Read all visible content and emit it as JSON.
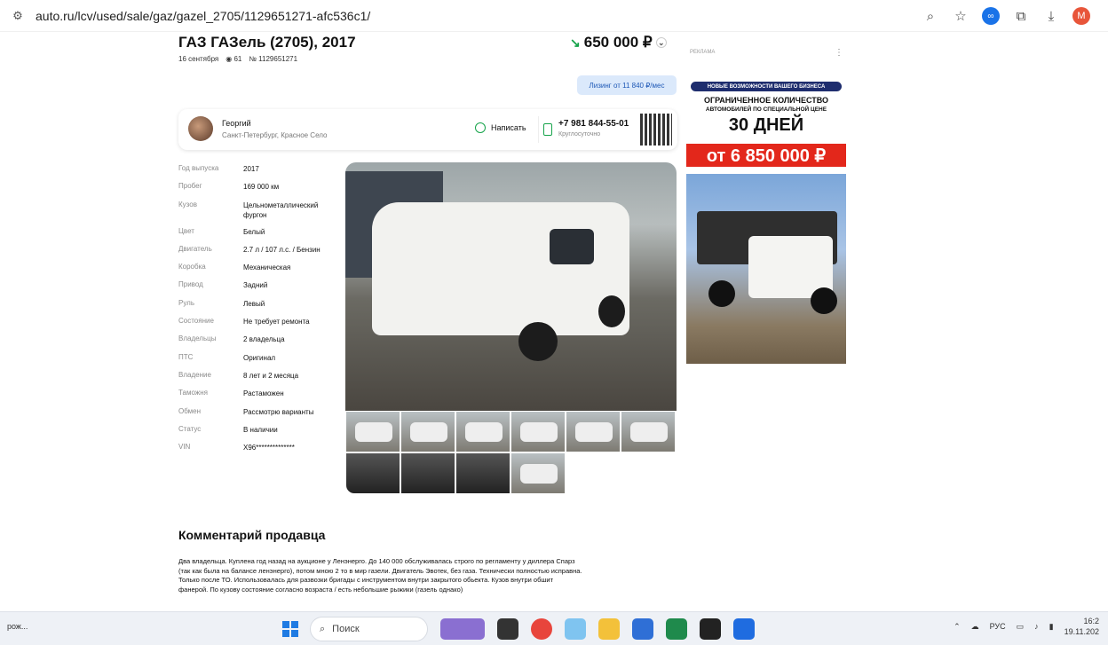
{
  "browser": {
    "url": "auto.ru/lcv/used/sale/gaz/gazel_2705/1129651271-afc536c1/",
    "profile_letter": "M"
  },
  "listing": {
    "title": "ГАЗ ГАЗель (2705), 2017",
    "date": "16 сентября",
    "views": "61",
    "number": "№ 1129651271",
    "price": "650 000 ₽",
    "leasing": "Лизинг от 11 840 ₽/мес"
  },
  "seller": {
    "name": "Георгий",
    "location": "Санкт-Петербург, Красное Село",
    "write_label": "Написать",
    "phone": "+7 981 844-55-01",
    "phone_hours": "Круглосуточно"
  },
  "specs": [
    {
      "k": "Год выпуска",
      "v": "2017"
    },
    {
      "k": "Пробег",
      "v": "169 000 км"
    },
    {
      "k": "Кузов",
      "v": "Цельнометаллический фургон"
    },
    {
      "k": "Цвет",
      "v": "Белый"
    },
    {
      "k": "Двигатель",
      "v": "2.7 л / 107 л.с. / Бензин"
    },
    {
      "k": "Коробка",
      "v": "Механическая"
    },
    {
      "k": "Привод",
      "v": "Задний"
    },
    {
      "k": "Руль",
      "v": "Левый"
    },
    {
      "k": "Состояние",
      "v": "Не требует ремонта"
    },
    {
      "k": "Владельцы",
      "v": "2 владельца"
    },
    {
      "k": "ПТС",
      "v": "Оригинал"
    },
    {
      "k": "Владение",
      "v": "8 лет и 2 месяца"
    },
    {
      "k": "Таможня",
      "v": "Растаможен"
    },
    {
      "k": "Обмен",
      "v": "Рассмотрю варианты"
    },
    {
      "k": "Статус",
      "v": "В наличии"
    },
    {
      "k": "VIN",
      "v": "X96**************"
    }
  ],
  "ad": {
    "label": "РЕКЛАМА",
    "pill": "НОВЫЕ ВОЗМОЖНОСТИ ВАШЕГО БИЗНЕСА",
    "line1": "ОГРАНИЧЕННОЕ КОЛИЧЕСТВО",
    "line2": "АВТОМОБИЛЕЙ ПО СПЕЦИАЛЬНОЙ ЦЕНЕ",
    "line3": "30 ДНЕЙ",
    "price": "от 6 850 000 ₽"
  },
  "comment": {
    "heading": "Комментарий продавца",
    "text": "Два владельца. Куплена год назад на аукционе у Ленэнерго. До 140 000 обслуживалась строго по регламенту у диллера Спарз (так как была на балансе ленэнерго), потом мною 2 то в мир газели. Двигатель Эвотек, без газа. Технически полностью исправна. Только после ТО. Использовалась для развозки бригады с инструментом внутри закрытого обьекта. Кузов внутри обшит фанерой. По кузову состояние согласно возраста / есть небольшие рыжики (газель однако)"
  },
  "taskbar": {
    "left_text": "рож...",
    "search_placeholder": "Поиск",
    "lang": "РУС",
    "time": "16:2",
    "date": "19.11.202"
  }
}
